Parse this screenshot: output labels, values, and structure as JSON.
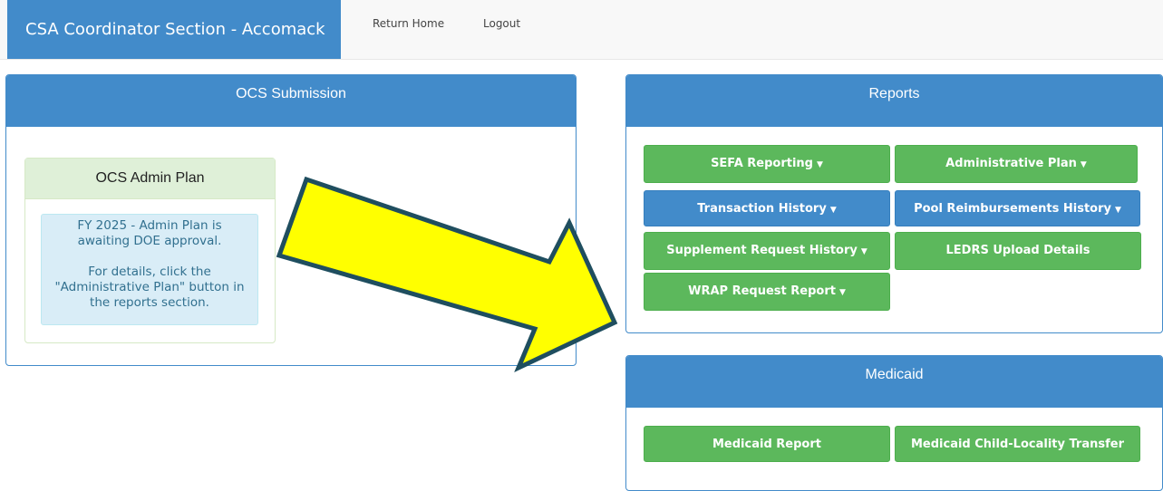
{
  "header": {
    "title": "CSA Coordinator Section - Accomack",
    "links": [
      "Return Home",
      "Logout"
    ]
  },
  "ocs": {
    "title": "OCS Submission",
    "admin_plan": {
      "title": "OCS Admin Plan",
      "message_lines": [
        "FY 2025 - Admin Plan is",
        "awaiting DOE approval.",
        "For details, click the",
        "\"Administrative Plan\" button in",
        "the reports section."
      ]
    }
  },
  "reports": {
    "title": "Reports",
    "buttons": [
      "SEFA Reporting",
      "Administrative Plan",
      "Transaction History",
      "Pool Reimbursements History",
      "Supplement Request History",
      "LEDRS Upload Details",
      "WRAP Request Report"
    ]
  },
  "medicaid": {
    "title": "Medicaid",
    "buttons": [
      "Medicaid Report",
      "Medicaid Child-Locality Transfer"
    ]
  },
  "colors": {
    "primary": "#428bca",
    "success": "#5cb85c",
    "arrow_fill": "#ffff00",
    "arrow_stroke": "#1f4e5f"
  },
  "icons": {
    "dropdown": "caret-down-icon",
    "annotation": "arrow-annotation-icon"
  }
}
